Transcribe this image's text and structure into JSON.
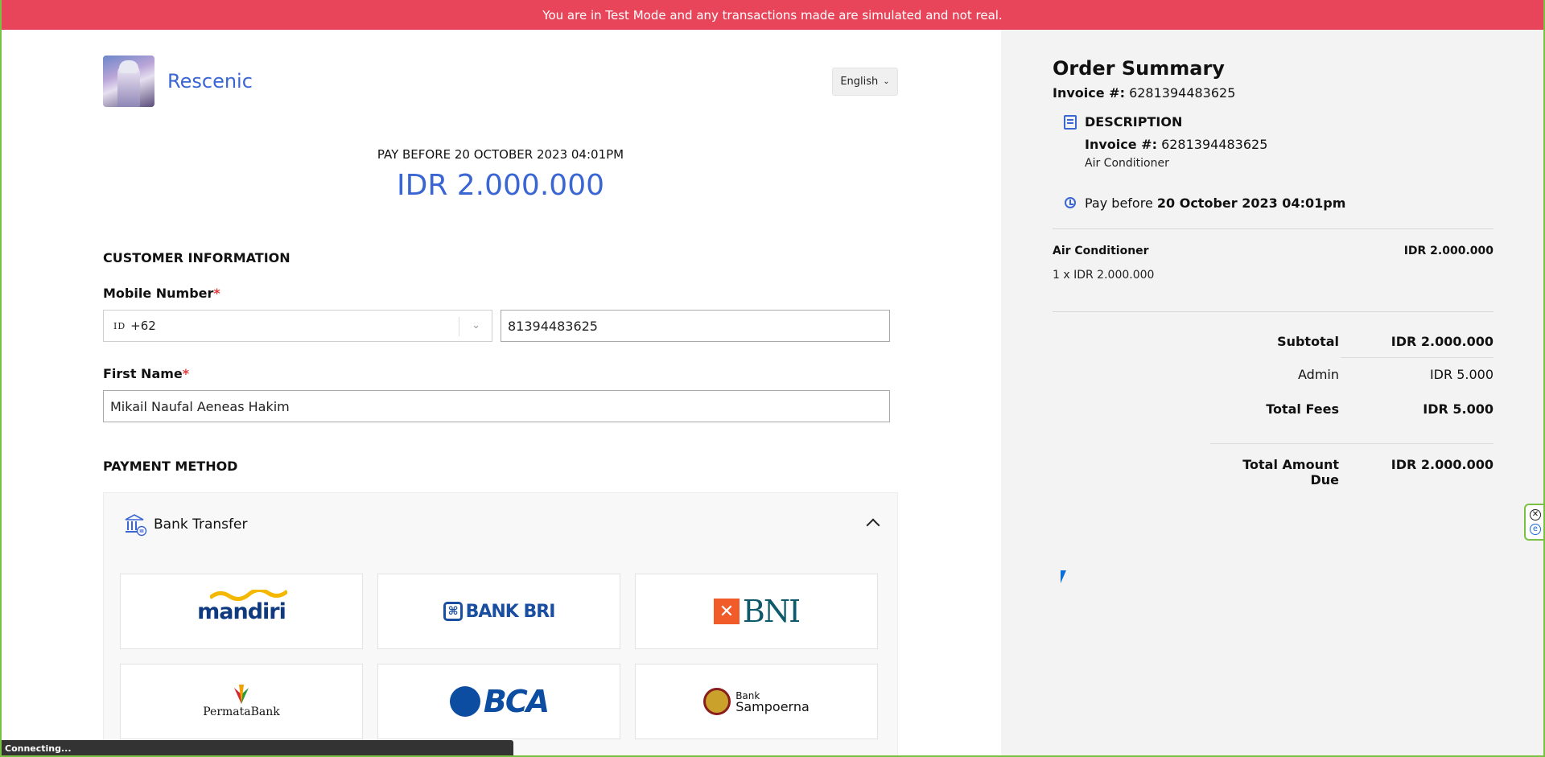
{
  "banner": {
    "text": "You are in Test Mode and any transactions made are simulated and not real."
  },
  "header": {
    "brand": "Rescenic",
    "language": "English"
  },
  "payment": {
    "pay_before": "PAY BEFORE 20 OCTOBER 2023 04:01PM",
    "amount": "IDR 2.000.000"
  },
  "customer": {
    "section_title": "CUSTOMER INFORMATION",
    "mobile_label": "Mobile Number",
    "country_flag": "ID",
    "country_code": "+62",
    "mobile_value": "81394483625",
    "first_name_label": "First Name",
    "first_name_value": "Mikail Naufal Aeneas Hakim",
    "required_mark": "*"
  },
  "payment_method": {
    "section_title": "PAYMENT METHOD",
    "group_label": "Bank Transfer",
    "banks": [
      "mandiri",
      "BANK BRI",
      "BNI",
      "PermataBank",
      "BCA",
      "Sampoerna"
    ],
    "bank_sampoerna_prefix": "Bank"
  },
  "order_summary": {
    "title": "Order Summary",
    "invoice_label": "Invoice #:",
    "invoice_number": "6281394483625",
    "description_title": "DESCRIPTION",
    "item_description": "Air Conditioner",
    "pay_before_prefix": "Pay before",
    "pay_before_date": "20 October 2023 04:01pm",
    "item_name": "Air Conditioner",
    "item_price": "IDR 2.000.000",
    "item_qty_line": "1 x IDR 2.000.000",
    "subtotal_label": "Subtotal",
    "subtotal_value": "IDR 2.000.000",
    "admin_label": "Admin",
    "admin_value": "IDR 5.000",
    "total_fees_label": "Total Fees",
    "total_fees_value": "IDR 5.000",
    "total_due_label": "Total Amount Due",
    "total_due_value": "IDR 2.000.000"
  },
  "statusbar": {
    "text": "Connecting..."
  },
  "colors": {
    "banner": "#e9455a",
    "accent": "#3a66d4",
    "frame": "#7ac143"
  }
}
